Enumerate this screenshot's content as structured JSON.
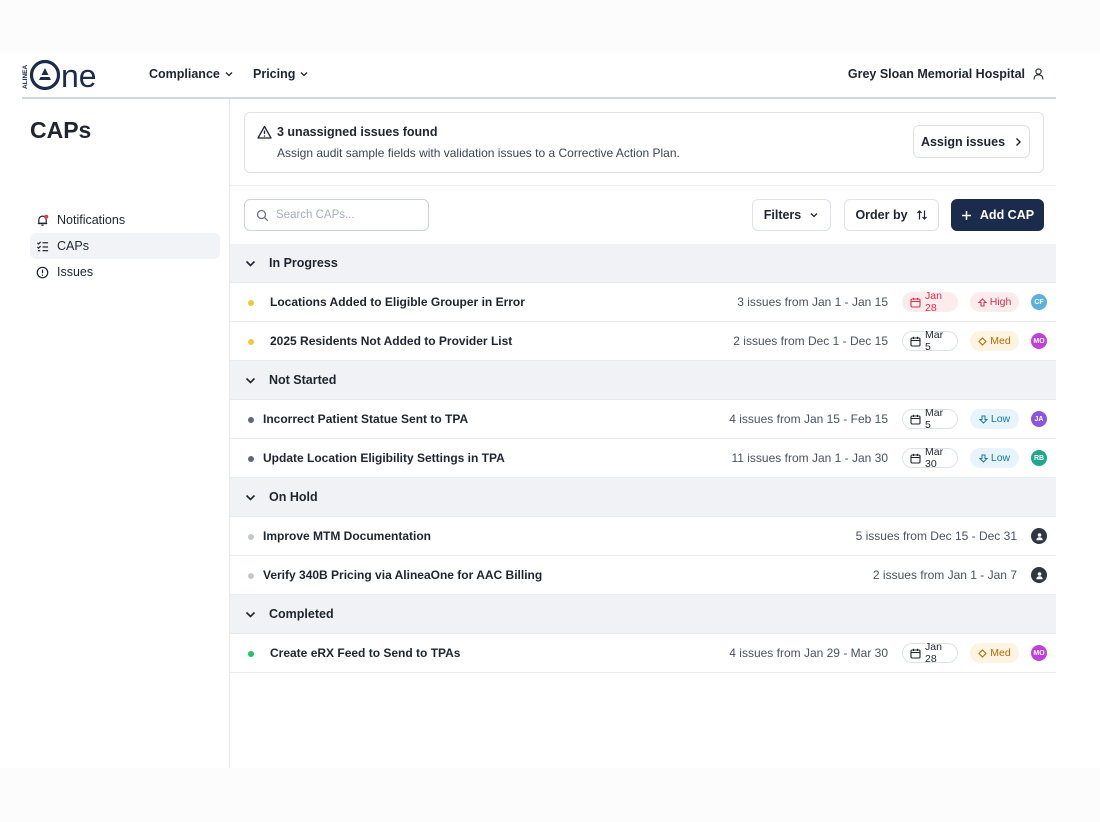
{
  "brand": {
    "logo_prefix": "ALINEA",
    "logo_main": "ne"
  },
  "topnav": {
    "menus": [
      {
        "label": "Compliance"
      },
      {
        "label": "Pricing"
      }
    ],
    "organization": "Grey Sloan Memorial Hospital"
  },
  "sidebar": {
    "title": "CAPs",
    "items": [
      {
        "label": "Notifications",
        "icon": "bell-alert-icon",
        "active": false
      },
      {
        "label": "CAPs",
        "icon": "list-check-icon",
        "active": true
      },
      {
        "label": "Issues",
        "icon": "alert-circle-icon",
        "active": false
      }
    ]
  },
  "banner": {
    "title": "3 unassigned issues found",
    "text": "Assign audit sample fields with validation issues to a Corrective Action Plan.",
    "button": "Assign issues"
  },
  "toolbar": {
    "search_placeholder": "Search CAPs...",
    "filters": "Filters",
    "order_by": "Order by",
    "add": "Add CAP"
  },
  "colors": {
    "in_progress": "#f5c542",
    "not_started": "#5f6878",
    "on_hold": "#c3c8d0",
    "completed": "#22c55e",
    "primary": "#1b2b4b"
  },
  "groups": [
    {
      "label": "In Progress",
      "status": "in_progress",
      "rows": [
        {
          "title": "Locations Added to Eligible Grouper in Error",
          "issues": "3 issues from Jan 1 - Jan 15",
          "due": "Jan 28",
          "overdue": true,
          "priority": "High",
          "assignee": "CF",
          "assignee_color": "#5ab0de"
        },
        {
          "title": "2025 Residents Not Added to Provider List",
          "issues": "2 issues from Dec 1 - Dec 15",
          "due": "Mar 5",
          "overdue": false,
          "priority": "Med",
          "assignee": "MO",
          "assignee_color": "#c23fd9"
        }
      ]
    },
    {
      "label": "Not Started",
      "status": "not_started",
      "rows": [
        {
          "title": "Incorrect Patient Statue Sent to TPA",
          "issues": "4 issues from Jan 15 - Feb 15",
          "due": "Mar 5",
          "overdue": false,
          "priority": "Low",
          "assignee": "JA",
          "assignee_color": "#8b55e0"
        },
        {
          "title": "Update Location Eligibility Settings in TPA",
          "issues": "11 issues from Jan 1  - Jan 30",
          "due": "Mar 30",
          "overdue": false,
          "priority": "Low",
          "assignee": "RB",
          "assignee_color": "#1fa88e"
        }
      ]
    },
    {
      "label": "On Hold",
      "status": "on_hold",
      "rows": [
        {
          "title": "Improve MTM Documentation",
          "issues": "5 issues from Dec 15 - Dec 31",
          "due": "",
          "overdue": false,
          "priority": "",
          "assignee": "",
          "assignee_color": ""
        },
        {
          "title": "Verify 340B Pricing via AlineaOne for AAC Billing",
          "issues": "2 issues from Jan 1 - Jan 7",
          "due": "",
          "overdue": false,
          "priority": "",
          "assignee": "",
          "assignee_color": ""
        }
      ]
    },
    {
      "label": "Completed",
      "status": "completed",
      "rows": [
        {
          "title": "Create eRX Feed to Send to TPAs",
          "issues": "4 issues from Jan 29 - Mar 30",
          "due": "Jan 28",
          "overdue": false,
          "priority": "Med",
          "assignee": "MO",
          "assignee_color": "#c23fd9"
        }
      ]
    }
  ]
}
